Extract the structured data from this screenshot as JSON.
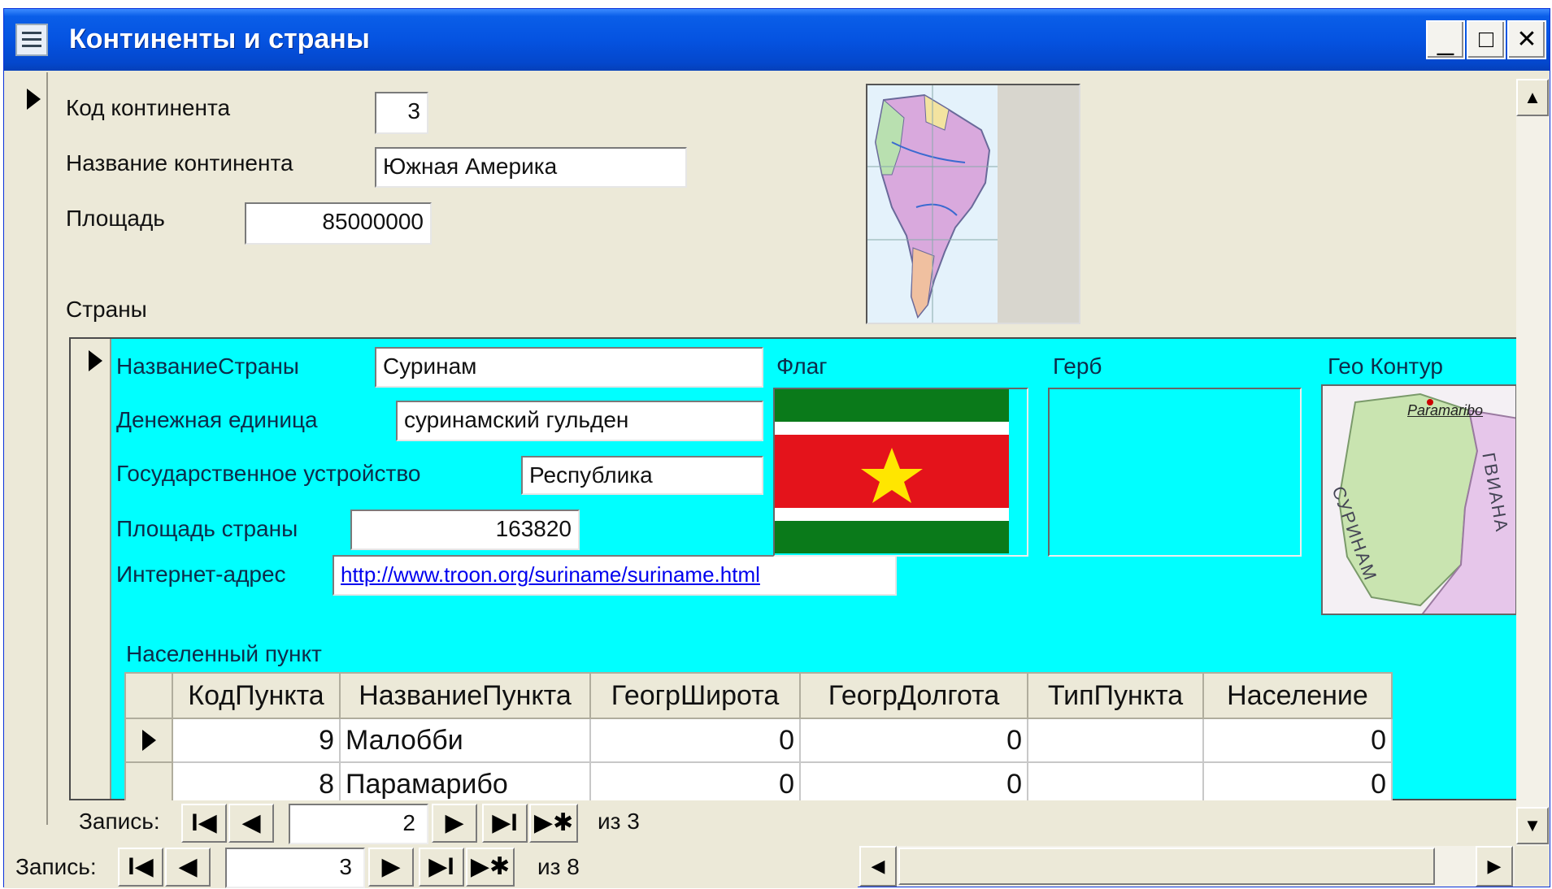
{
  "window": {
    "title": "Континенты и страны",
    "minimize": "_",
    "maximize": "□",
    "close": "✕"
  },
  "continent": {
    "code_label": "Код континента",
    "code_value": "3",
    "name_label": "Название континента",
    "name_value": "Южная Америка",
    "area_label": "Площадь",
    "area_value": "85000000",
    "map_icon": "south-america-map-image"
  },
  "countries": {
    "section_label": "Страны",
    "name_label": "НазваниеСтраны",
    "name_value": "Суринам",
    "currency_label": "Денежная единица",
    "currency_value": "суринамский гульден",
    "government_label": "Государственное устройство",
    "government_value": "Республика",
    "area_label": "Площадь страны",
    "area_value": "163820",
    "url_label": "Интернет-адрес",
    "url_value": "http://www.troon.org/suriname/suriname.html",
    "flag_label": "Флаг",
    "coat_label": "Герб",
    "geo_label": "Гео Контур",
    "geo_map_labels": [
      "Paramaribo",
      "СУРИНАМ",
      "ГВИАНА"
    ],
    "flag_colors": {
      "green": "#0a7a1a",
      "white": "#ffffff",
      "red": "#e4131b",
      "star": "#ffe600"
    }
  },
  "settlements": {
    "section_label": "Населенный пункт",
    "columns": [
      "КодПункта",
      "НазваниеПункта",
      "ГеогрШирота",
      "ГеогрДолгота",
      "ТипПункта",
      "Население"
    ],
    "rows": [
      [
        "9",
        "Малобби",
        "0",
        "0",
        "",
        "0"
      ],
      [
        "8",
        "Парамарибо",
        "0",
        "0",
        "",
        "0"
      ]
    ]
  },
  "subform_nav": {
    "label": "Запись:",
    "current": "2",
    "of_text": "из 3",
    "first": "I◀",
    "prev": "◀",
    "next": "▶",
    "last": "▶I",
    "new": "▶✱"
  },
  "main_nav": {
    "label": "Запись:",
    "current": "3",
    "of_text": "из 8",
    "first": "I◀",
    "prev": "◀",
    "next": "▶",
    "last": "▶I",
    "new": "▶✱"
  },
  "scroll": {
    "up": "▲",
    "down": "▼",
    "left": "◀",
    "right": "▶"
  }
}
